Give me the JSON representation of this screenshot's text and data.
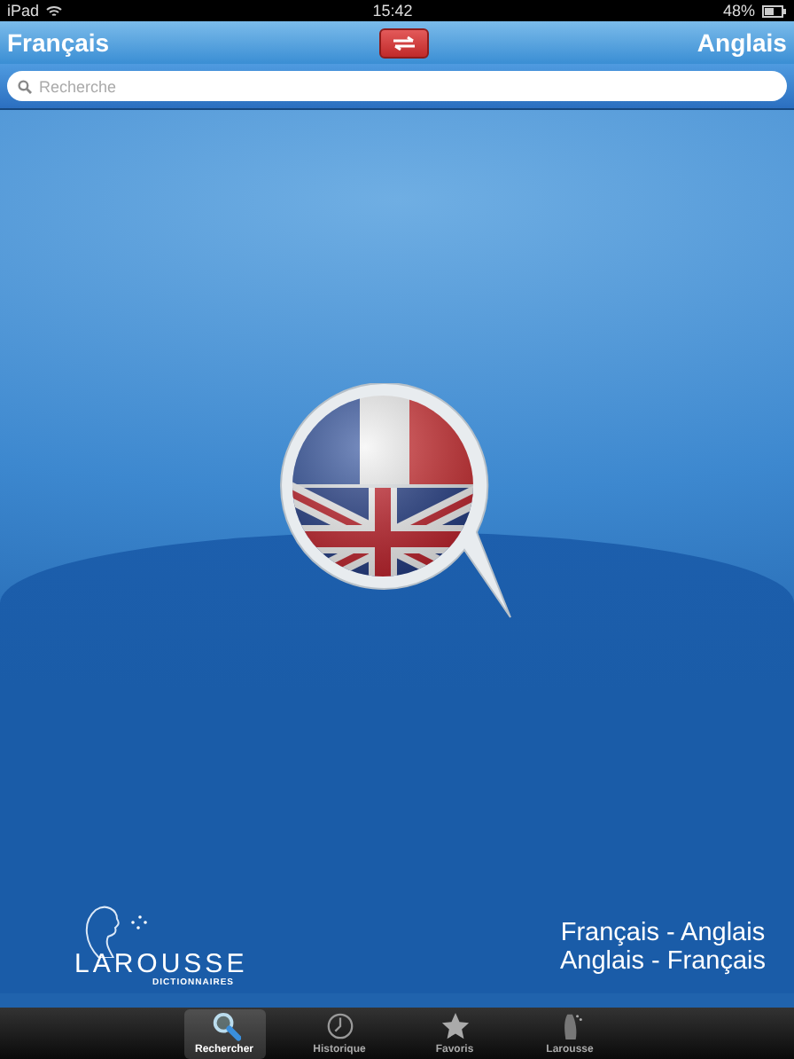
{
  "status_bar": {
    "device": "iPad",
    "time": "15:42",
    "battery": "48%"
  },
  "header": {
    "source_language": "Français",
    "target_language": "Anglais"
  },
  "search": {
    "placeholder": "Recherche"
  },
  "logo": {
    "brand": "LAROUSSE",
    "subtitle": "DICTIONNAIRES"
  },
  "dictionaries": [
    "Français - Anglais",
    "Anglais - Français"
  ],
  "tabs": [
    {
      "label": "Rechercher",
      "kind": "search",
      "selected": true
    },
    {
      "label": "Historique",
      "kind": "history",
      "selected": false
    },
    {
      "label": "Favoris",
      "kind": "favorites",
      "selected": false
    },
    {
      "label": "Larousse",
      "kind": "larousse",
      "selected": false
    }
  ]
}
